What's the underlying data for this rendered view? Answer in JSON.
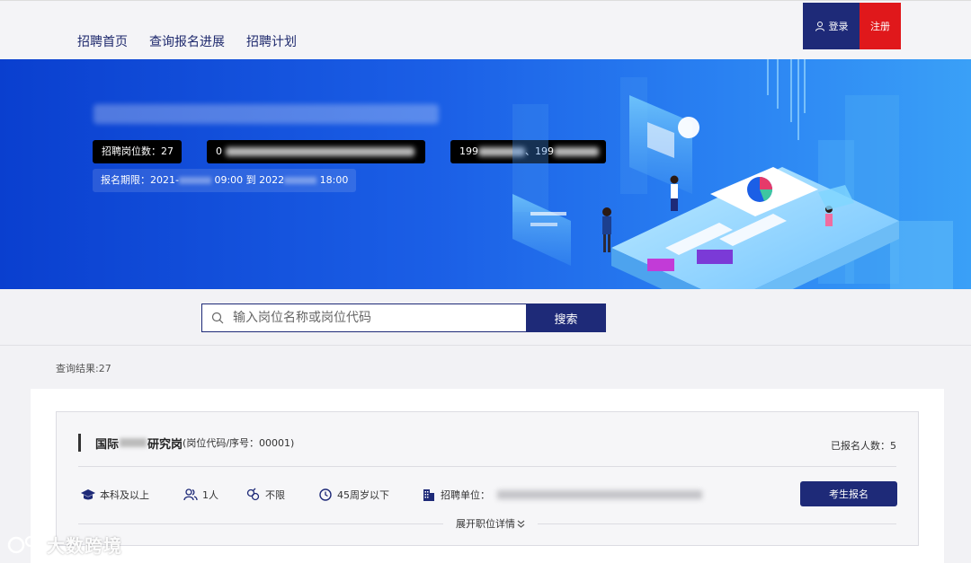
{
  "nav": {
    "items": [
      "招聘首页",
      "查询报名进展",
      "招聘计划"
    ]
  },
  "auth": {
    "login": "登录",
    "register": "注册"
  },
  "banner": {
    "positions_label": "招聘岗位数：27",
    "phone_prefix_1": "199",
    "phone_separator": "、",
    "phone_prefix_2": "199",
    "contact_prefix": "0",
    "date_label": "报名期限：2021-",
    "date_mid": "09:00 到 2022",
    "date_end": "18:00"
  },
  "search": {
    "placeholder": "输入岗位名称或岗位代码",
    "button": "搜索"
  },
  "results": {
    "count_label": "查询结果:27"
  },
  "job": {
    "name_start": "国际",
    "name_end": "研究岗",
    "code": "(岗位代码/序号：00001)",
    "applicants": "已报名人数：5",
    "education": "本科及以上",
    "headcount": "1人",
    "gender": "不限",
    "age": "45周岁以下",
    "unit_label": "招聘单位：",
    "apply": "考生报名",
    "expand": "展开职位详情"
  },
  "watermark": "大数跨境",
  "colors": {
    "navy": "#1e2a78",
    "red": "#e0181b",
    "banner_blue": "#1b5fe6"
  }
}
